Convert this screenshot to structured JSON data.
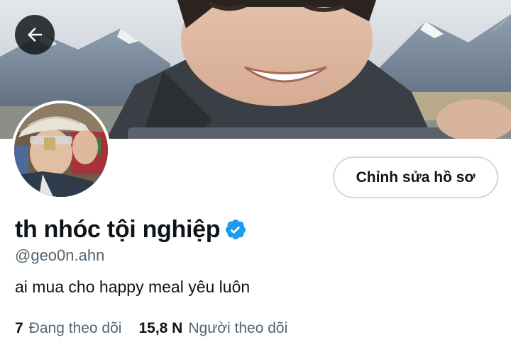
{
  "header": {
    "back_icon": "arrow-left-icon",
    "banner_alt": "profile-banner"
  },
  "profile": {
    "avatar_icon": "avatar",
    "edit_button_label": "Chỉnh sửa hồ sơ",
    "display_name": "th nhóc tội nghiệp",
    "verified_icon": "verified-badge-icon",
    "verified_color": "#1d9bf0",
    "handle": "@geo0n.ahn",
    "bio": "ai mua cho happy meal yêu luôn"
  },
  "stats": {
    "following_count": "7",
    "following_label": "Đang theo dõi",
    "followers_count": "15,8 N",
    "followers_label": "Người theo dõi"
  }
}
